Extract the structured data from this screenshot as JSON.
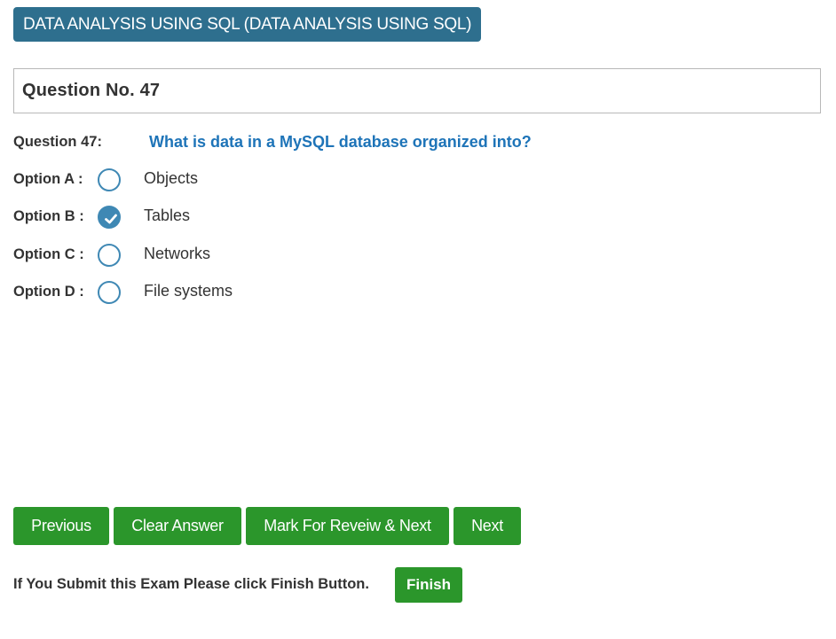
{
  "exam": {
    "subject_title": "DATA ANALYSIS USING SQL (DATA ANALYSIS USING SQL)"
  },
  "question": {
    "header": "Question No. 47",
    "label": "Question 47:",
    "text": "What is data in a MySQL database organized into?"
  },
  "options": [
    {
      "label": "Option A :",
      "text": "Objects",
      "selected": false
    },
    {
      "label": "Option B :",
      "text": "Tables",
      "selected": true
    },
    {
      "label": "Option C :",
      "text": "Networks",
      "selected": false
    },
    {
      "label": "Option D :",
      "text": "File systems",
      "selected": false
    }
  ],
  "buttons": {
    "previous": "Previous",
    "clear_answer": "Clear Answer",
    "mark_review_next": "Mark For Reveiw & Next",
    "next": "Next",
    "finish": "Finish"
  },
  "footer": {
    "submit_note": "If You Submit this Exam Please click Finish Button."
  },
  "colors": {
    "badge_bg": "#2e6f8e",
    "question_text": "#1e74b8",
    "radio_accent": "#3f88b4",
    "button_green": "#2b962b"
  },
  "icons": {
    "radio_selected": "check-icon"
  }
}
